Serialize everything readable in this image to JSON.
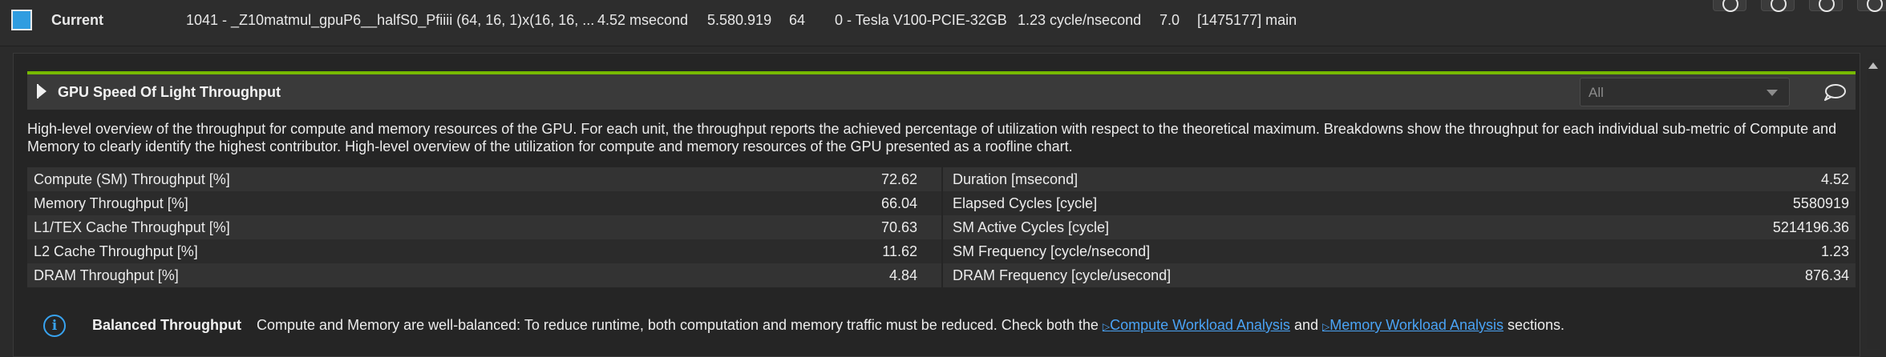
{
  "result_row": {
    "name": "Current",
    "kernel": "1041 - _Z10matmul_gpuP6__halfS0_Pfiiii (64, 16, 1)x(16, 16, ...",
    "duration": "4.52 msecond",
    "cycles": "5.580.919",
    "registers": "64",
    "device": "0 - Tesla V100-PCIE-32GB",
    "frequency": "1.23 cycle/nsecond",
    "cc": "7.0",
    "process": "[1475177] main",
    "accent_color": "#2f9de0"
  },
  "section": {
    "title": "GPU Speed Of Light Throughput",
    "filter_value": "All",
    "accent_color": "#76b900",
    "description": "High-level overview of the throughput for compute and memory resources of the GPU. For each unit, the throughput reports the achieved percentage of utilization with respect to the theoretical maximum. Breakdowns show the throughput for each individual sub-metric of Compute and Memory to clearly identify the highest contributor. High-level overview of the utilization for compute and memory resources of the GPU presented as a roofline chart."
  },
  "metrics_left": [
    {
      "label": "Compute (SM) Throughput [%]",
      "value": "72.62"
    },
    {
      "label": "Memory Throughput [%]",
      "value": "66.04"
    },
    {
      "label": "L1/TEX Cache Throughput [%]",
      "value": "70.63"
    },
    {
      "label": "L2 Cache Throughput [%]",
      "value": "11.62"
    },
    {
      "label": "DRAM Throughput [%]",
      "value": "4.84"
    }
  ],
  "metrics_right": [
    {
      "label": "Duration [msecond]",
      "value": "4.52"
    },
    {
      "label": "Elapsed Cycles [cycle]",
      "value": "5580919"
    },
    {
      "label": "SM Active Cycles [cycle]",
      "value": "5214196.36"
    },
    {
      "label": "SM Frequency [cycle/nsecond]",
      "value": "1.23"
    },
    {
      "label": "DRAM Frequency [cycle/usecond]",
      "value": "876.34"
    }
  ],
  "recommendation": {
    "icon": "info-icon",
    "title": "Balanced Throughput",
    "text_before": "Compute and Memory are well-balanced: To reduce runtime, both computation and memory traffic must be reduced. Check both the",
    "link1": "Compute Workload Analysis",
    "text_between": "and",
    "link2": "Memory Workload Analysis",
    "text_after": "sections.",
    "link_color": "#4aa3f5"
  }
}
